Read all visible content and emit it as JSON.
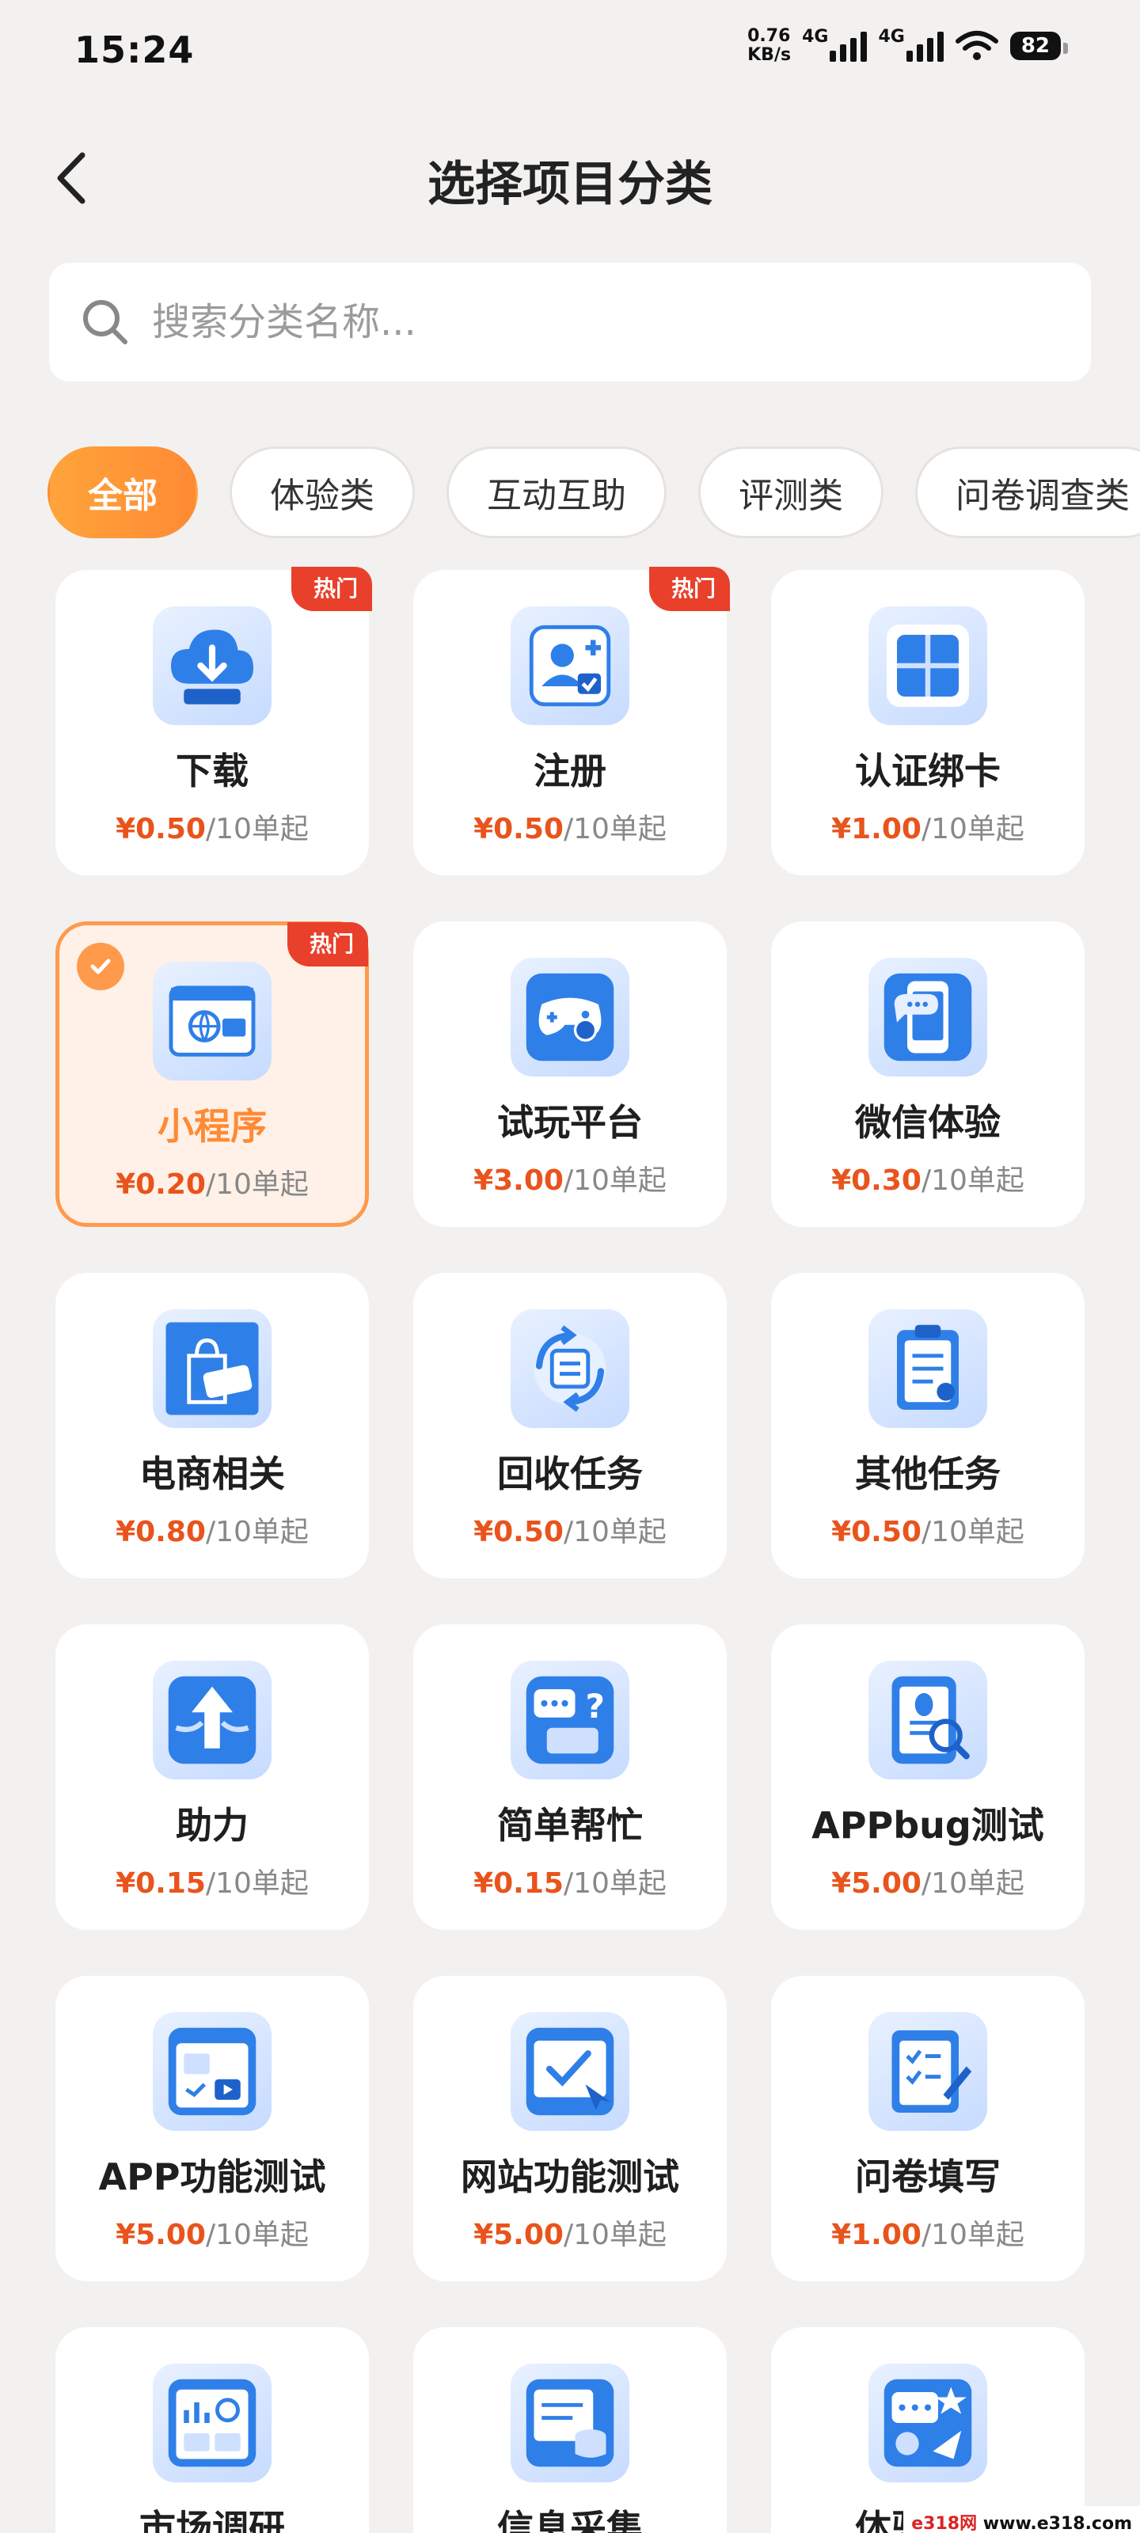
{
  "status": {
    "time": "15:24",
    "net_speed_value": "0.76",
    "net_speed_unit": "KB/s",
    "signal1": "4G",
    "signal2": "4G",
    "battery": "82"
  },
  "header": {
    "title": "选择项目分类"
  },
  "search": {
    "placeholder": "搜索分类名称..."
  },
  "tabs": [
    {
      "label": "全部",
      "active": true
    },
    {
      "label": "体验类"
    },
    {
      "label": "互动互助"
    },
    {
      "label": "评测类"
    },
    {
      "label": "问卷调查类"
    }
  ],
  "price_suffix": "/10单起",
  "hot_label": "热门",
  "categories": [
    {
      "name": "下载",
      "price": "¥0.50",
      "hot": true,
      "icon": "cloud-download-icon"
    },
    {
      "name": "注册",
      "price": "¥0.50",
      "hot": true,
      "icon": "user-register-icon"
    },
    {
      "name": "认证绑卡",
      "price": "¥1.00",
      "icon": "card-grid-icon"
    },
    {
      "name": "小程序",
      "price": "¥0.20",
      "hot": true,
      "selected": true,
      "icon": "mini-program-icon"
    },
    {
      "name": "试玩平台",
      "price": "¥3.00",
      "icon": "gamepad-icon"
    },
    {
      "name": "微信体验",
      "price": "¥0.30",
      "icon": "wechat-phone-icon"
    },
    {
      "name": "电商相关",
      "price": "¥0.80",
      "icon": "shopping-bag-icon"
    },
    {
      "name": "回收任务",
      "price": "¥0.50",
      "icon": "recycle-task-icon"
    },
    {
      "name": "其他任务",
      "price": "¥0.50",
      "icon": "clipboard-icon"
    },
    {
      "name": "助力",
      "price": "¥0.15",
      "icon": "boost-arrow-icon"
    },
    {
      "name": "简单帮忙",
      "price": "¥0.15",
      "icon": "help-chat-icon"
    },
    {
      "name": "APPbug测试",
      "price": "¥5.00",
      "icon": "bug-test-icon"
    },
    {
      "name": "APP功能测试",
      "price": "¥5.00",
      "icon": "app-function-icon"
    },
    {
      "name": "网站功能测试",
      "price": "¥5.00",
      "icon": "website-test-icon"
    },
    {
      "name": "问卷填写",
      "price": "¥1.00",
      "icon": "survey-icon"
    },
    {
      "name": "市场调研",
      "price": "",
      "icon": "market-research-icon"
    },
    {
      "name": "信息采集",
      "price": "",
      "icon": "data-collect-icon"
    },
    {
      "name": "体验反馈",
      "price": "",
      "icon": "feedback-icon"
    }
  ],
  "watermark": {
    "text1": "e318网",
    "text2": "www.e318.com"
  },
  "colors": {
    "accent": "#ff8a34",
    "price": "#e8541c",
    "hot": "#e8402a",
    "icon_blue": "#2f7fe8"
  }
}
